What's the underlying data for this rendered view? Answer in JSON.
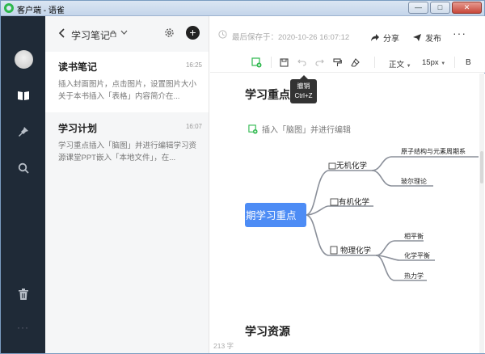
{
  "window": {
    "title": "客户端 - 语雀",
    "controls": [
      "—",
      "□",
      "✕"
    ]
  },
  "rail": {
    "items": [
      "avatar",
      "book-icon",
      "pin-icon",
      "search-icon",
      "trash-icon"
    ],
    "more": "···"
  },
  "notelist": {
    "title": "学习笔记",
    "notes": [
      {
        "title": "读书笔记",
        "time": "16:25",
        "snippet": "插入封面图片，点击图片，设置图片大小关于本书插入「表格」内容简介在..."
      },
      {
        "title": "学习计划",
        "time": "16:07",
        "snippet": "学习重点插入「脑图」并进行编辑学习资源课堂PPT嵌入「本地文件」，在..."
      }
    ]
  },
  "toolbar": {
    "saved_text": "最后保存于：2020-10-26 16:07:12",
    "share_label": "分享",
    "publish_label": "发布",
    "more": "···",
    "paragraph_style": "正文",
    "font_size": "15px",
    "bold": "B"
  },
  "tooltip": {
    "title": "撤销",
    "shortcut": "Ctrl+Z"
  },
  "editor": {
    "heading1": "学习重点",
    "insert_hint": "插入「脑图」并进行编辑",
    "mindmap": {
      "root": "期学习重点",
      "branches": [
        {
          "label": "无机化学",
          "children": [
            "原子结构与元素周期系",
            "玻尔理论"
          ]
        },
        {
          "label": "有机化学",
          "children": []
        },
        {
          "label": "物理化学",
          "children": [
            "相平衡",
            "化学平衡",
            "热力学"
          ]
        }
      ]
    },
    "heading2": "学习资源",
    "word_count": "213 字"
  },
  "colors": {
    "rail_bg": "#1f2a37",
    "accent_green": "#2db84d",
    "mindmap_root": "#4d8cf5",
    "mindmap_line": "#8a8f99"
  }
}
